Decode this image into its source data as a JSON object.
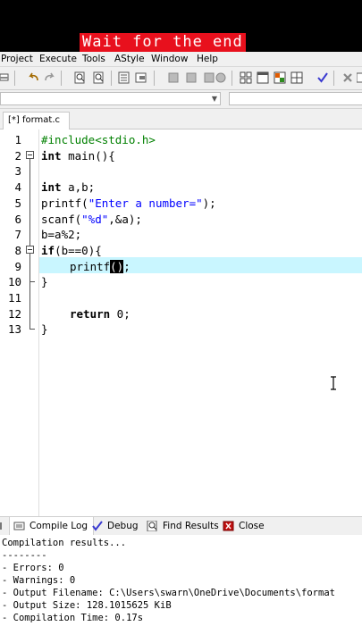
{
  "banner": {
    "caption": "Wait for the end"
  },
  "menu": {
    "items": [
      "Project",
      "Execute",
      "Tools",
      "AStyle",
      "Window",
      "Help"
    ]
  },
  "tab": {
    "file_name": "[*] format.c"
  },
  "editor": {
    "lines": [
      {
        "n": "1"
      },
      {
        "n": "2"
      },
      {
        "n": "3"
      },
      {
        "n": "4"
      },
      {
        "n": "5"
      },
      {
        "n": "6"
      },
      {
        "n": "7"
      },
      {
        "n": "8"
      },
      {
        "n": "9"
      },
      {
        "n": "10"
      },
      {
        "n": "11"
      },
      {
        "n": "12"
      },
      {
        "n": "13"
      }
    ],
    "code": {
      "l1": "#include<stdio.h>",
      "l2_kw": "int",
      "l2_rest": " main(){",
      "l4_kw": "int",
      "l4_rest": " a,b;",
      "l5_fn": "printf(",
      "l5_str": "\"Enter a number=\"",
      "l5_end": ");",
      "l6_fn": "scanf(",
      "l6_str": "\"%d\"",
      "l6_end": ",&a);",
      "l7": "b=a%2;",
      "l8_kw": "if",
      "l8_rest": "(b==0){",
      "l9_fn": "printf",
      "l9_sel": "()",
      "l9_end": ";",
      "l10": "}",
      "l12_kw": "return",
      "l12_rest": " 0;",
      "l13": "}"
    }
  },
  "panel": {
    "tabs": {
      "compile_log": "Compile Log",
      "debug": "Debug",
      "find_results": "Find Results",
      "close": "Close"
    },
    "log": [
      "Compilation results...",
      "--------",
      "- Errors: 0",
      "- Warnings: 0",
      "- Output Filename: C:\\Users\\swarn\\OneDrive\\Documents\\format",
      "- Output Size: 128.1015625 KiB",
      "- Compilation Time: 0.17s"
    ]
  },
  "colors": {
    "banner_bg": "#e8101d",
    "current_line": "#c9f6ff",
    "string": "#0000ff",
    "preprocessor": "#008000"
  }
}
